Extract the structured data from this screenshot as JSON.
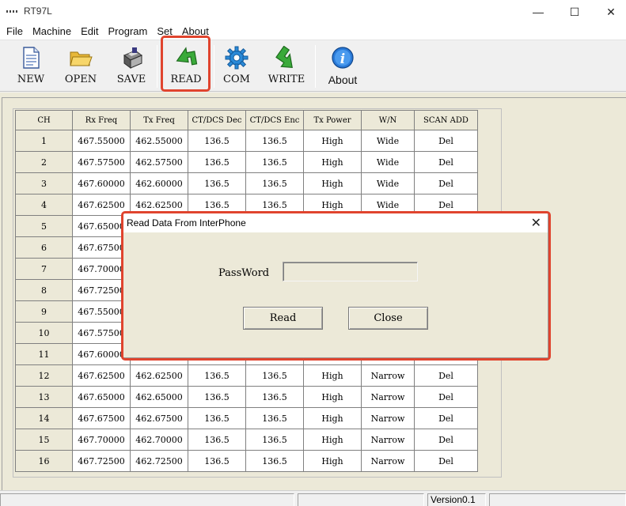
{
  "window": {
    "title": "RT97L",
    "minimize_glyph": "—",
    "maximize_glyph": "☐",
    "close_glyph": "✕"
  },
  "menu": [
    "File",
    "Machine",
    "Edit",
    "Program",
    "Set",
    "About"
  ],
  "toolbar": {
    "new_label": "NEW",
    "open_label": "OPEN",
    "save_label": "SAVE",
    "read_label": "READ",
    "com_label": "COM",
    "write_label": "WRITE",
    "about_label": "About",
    "highlight_color": "#e0442e"
  },
  "table": {
    "headers": [
      "CH",
      "Rx Freq",
      "Tx Freq",
      "CT/DCS Dec",
      "CT/DCS Enc",
      "Tx Power",
      "W/N",
      "SCAN ADD"
    ],
    "rows": [
      [
        "1",
        "467.55000",
        "462.55000",
        "136.5",
        "136.5",
        "High",
        "Wide",
        "Del"
      ],
      [
        "2",
        "467.57500",
        "462.57500",
        "136.5",
        "136.5",
        "High",
        "Wide",
        "Del"
      ],
      [
        "3",
        "467.60000",
        "462.60000",
        "136.5",
        "136.5",
        "High",
        "Wide",
        "Del"
      ],
      [
        "4",
        "467.62500",
        "462.62500",
        "136.5",
        "136.5",
        "High",
        "Wide",
        "Del"
      ],
      [
        "5",
        "467.65000",
        "",
        "",
        "",
        "",
        "",
        ""
      ],
      [
        "6",
        "467.67500",
        "",
        "",
        "",
        "",
        "",
        ""
      ],
      [
        "7",
        "467.70000",
        "",
        "",
        "",
        "",
        "",
        ""
      ],
      [
        "8",
        "467.72500",
        "",
        "",
        "",
        "",
        "",
        ""
      ],
      [
        "9",
        "467.55000",
        "",
        "",
        "",
        "",
        "",
        ""
      ],
      [
        "10",
        "467.57500",
        "",
        "",
        "",
        "",
        "",
        ""
      ],
      [
        "11",
        "467.60000",
        "",
        "",
        "",
        "",
        "",
        ""
      ],
      [
        "12",
        "467.62500",
        "462.62500",
        "136.5",
        "136.5",
        "High",
        "Narrow",
        "Del"
      ],
      [
        "13",
        "467.65000",
        "462.65000",
        "136.5",
        "136.5",
        "High",
        "Narrow",
        "Del"
      ],
      [
        "14",
        "467.67500",
        "462.67500",
        "136.5",
        "136.5",
        "High",
        "Narrow",
        "Del"
      ],
      [
        "15",
        "467.70000",
        "462.70000",
        "136.5",
        "136.5",
        "High",
        "Narrow",
        "Del"
      ],
      [
        "16",
        "467.72500",
        "462.72500",
        "136.5",
        "136.5",
        "High",
        "Narrow",
        "Del"
      ]
    ]
  },
  "dialog": {
    "title": "Read Data From InterPhone",
    "password_label": "PassWord",
    "password_value": "",
    "read_button": "Read",
    "close_button": "Close"
  },
  "status": {
    "version": "Version0.1"
  }
}
